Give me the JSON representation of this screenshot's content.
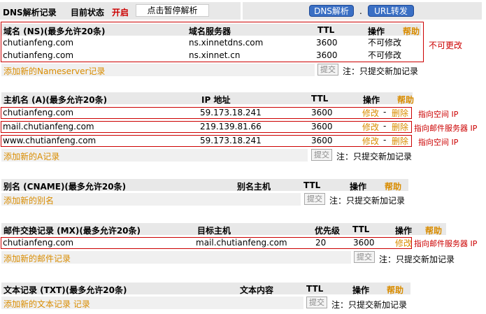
{
  "top": {
    "title": "DNS解析记录",
    "status_label": "目前状态",
    "status_value": "开启",
    "pause_button": "点击暂停解析",
    "dns_tab": "DNS解析",
    "separator": ".",
    "url_tab": "URL转发"
  },
  "ns": {
    "header": {
      "name": "域名 (NS)(最多允许20条)",
      "server": "域名服务器",
      "ttl": "TTL",
      "op": "操作",
      "help": "帮助"
    },
    "rows": [
      {
        "domain": "chutianfeng.com",
        "server": "ns.xinnetdns.com",
        "ttl": "3600",
        "op": "不可修改"
      },
      {
        "domain": "chutianfeng.com",
        "server": "ns.xinnet.cn",
        "ttl": "3600",
        "op": "不可修改"
      }
    ],
    "annotation": "不可更改",
    "add_link": "添加新的Nameserver记录",
    "submit": "提交",
    "note": "注：只提交新加记录"
  },
  "a": {
    "header": {
      "name": "主机名 (A)(最多允许20条)",
      "ip": "IP 地址",
      "ttl": "TTL",
      "op": "操作",
      "help": "帮助"
    },
    "rows": [
      {
        "host": "chutianfeng.com",
        "ip": "59.173.18.241",
        "ttl": "3600",
        "modify": "修改",
        "dash": "-",
        "delete": "删除",
        "annotation": "指向空间 IP"
      },
      {
        "host": "mail.chutianfeng.com",
        "ip": "219.139.81.66",
        "ttl": "3600",
        "modify": "修改",
        "dash": "-",
        "delete": "删除",
        "annotation": "指向邮件服务器 IP"
      },
      {
        "host": "www.chutianfeng.com",
        "ip": "59.173.18.241",
        "ttl": "3600",
        "modify": "修改",
        "dash": "-",
        "delete": "删除",
        "annotation": "指向空间 IP"
      }
    ],
    "add_link": "添加新的A记录",
    "submit": "提交",
    "note": "注：只提交新加记录"
  },
  "cname": {
    "header": {
      "name": "别名 (CNAME)(最多允许20条)",
      "target": "别名主机",
      "ttl": "TTL",
      "op": "操作",
      "help": "帮助"
    },
    "add_link": "添加新的别名",
    "submit": "提交",
    "note": "注：只提交新加记录"
  },
  "mx": {
    "header": {
      "name": "邮件交换记录 (MX)(最多允许20条)",
      "target": "目标主机",
      "priority": "优先级",
      "ttl": "TTL",
      "op": "操作",
      "help": "帮助"
    },
    "rows": [
      {
        "domain": "chutianfeng.com",
        "target": "mail.chutianfeng.com",
        "priority": "20",
        "ttl": "3600",
        "modify": "修改",
        "annotation": "指向邮件服务器 IP"
      }
    ],
    "add_link": "添加新的邮件记录",
    "submit": "提交",
    "note": "注：只提交新加记录"
  },
  "txt": {
    "header": {
      "name": "文本记录 (TXT)(最多允许20条)",
      "content": "文本内容",
      "ttl": "TTL",
      "op": "操作",
      "help": "帮助"
    },
    "add_link": "添加新的文本记录 记录",
    "submit": "提交",
    "note": "注：只提交新加记录"
  }
}
